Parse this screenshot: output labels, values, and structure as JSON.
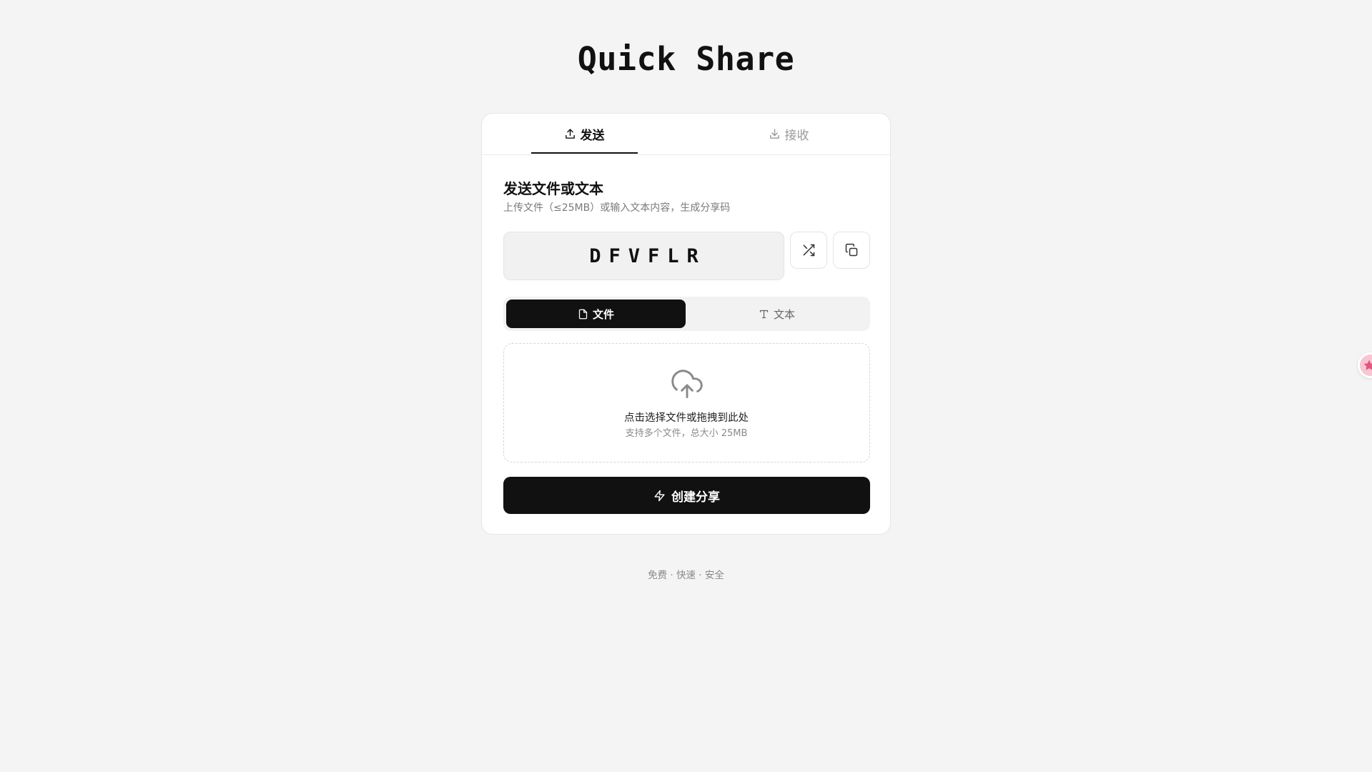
{
  "app": {
    "title": "Quick Share",
    "footer": "免费 · 快速 · 安全"
  },
  "tabs": [
    {
      "label": "发送",
      "icon": "upload-icon",
      "active": true
    },
    {
      "label": "接收",
      "icon": "download-icon",
      "active": false
    }
  ],
  "send": {
    "heading": "发送文件或文本",
    "subtitle": "上传文件（≤25MB）或输入文本内容，生成分享码",
    "share_code": "DFVFLR",
    "mode_options": [
      {
        "label": "文件",
        "icon": "file-icon",
        "active": true
      },
      {
        "label": "文本",
        "icon": "text-icon",
        "active": false
      }
    ],
    "dropzone": {
      "title": "点击选择文件或拖拽到此处",
      "subtitle": "支持多个文件，总大小 25MB",
      "icon": "cloud-upload-icon"
    },
    "create_button": {
      "label": "创建分享",
      "icon": "zap-icon"
    }
  },
  "colors": {
    "background": "#f4f4f4",
    "card": "#ffffff",
    "primary": "#111111",
    "muted": "#9a9a9a",
    "widget": "#f7c6d3"
  }
}
